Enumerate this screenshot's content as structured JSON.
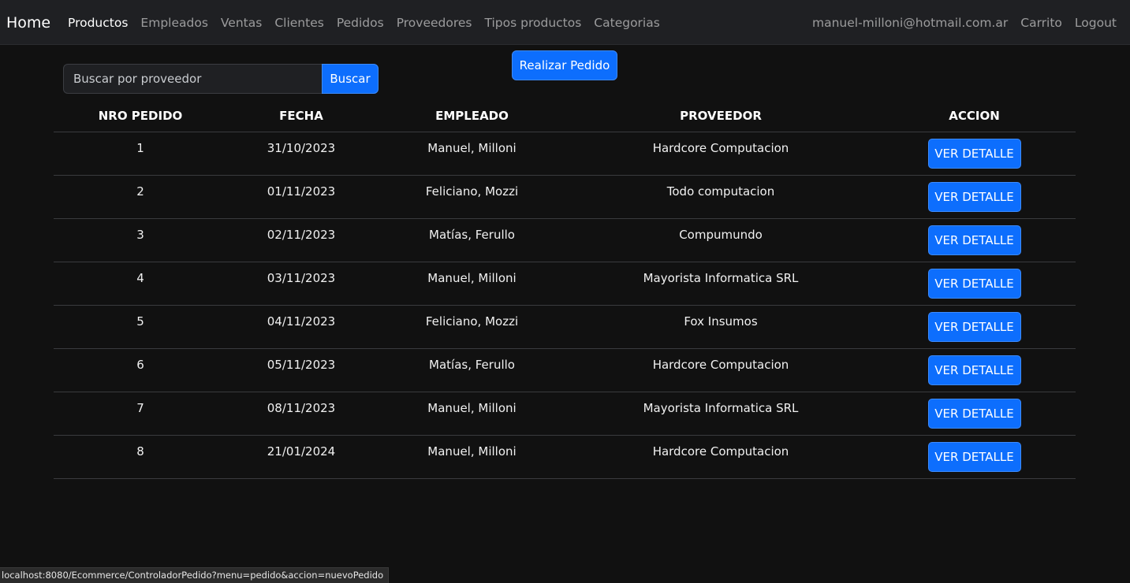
{
  "nav": {
    "brand": "Home",
    "links": [
      "Productos",
      "Empleados",
      "Ventas",
      "Clientes",
      "Pedidos",
      "Proveedores",
      "Tipos productos",
      "Categorias"
    ],
    "user_email": "manuel-milloni@hotmail.com.ar",
    "cart": "Carrito",
    "logout": "Logout"
  },
  "search": {
    "placeholder": "Buscar por proveedor",
    "value": "",
    "button": "Buscar"
  },
  "order_button": "Realizar Pedido",
  "table": {
    "headers": [
      "NRO PEDIDO",
      "FECHA",
      "EMPLEADO",
      "PROVEEDOR",
      "ACCION"
    ],
    "action_label": "VER DETALLE",
    "rows": [
      {
        "nro": "1",
        "fecha": "31/10/2023",
        "empleado": "Manuel, Milloni",
        "proveedor": "Hardcore Computacion"
      },
      {
        "nro": "2",
        "fecha": "01/11/2023",
        "empleado": "Feliciano, Mozzi",
        "proveedor": "Todo computacion"
      },
      {
        "nro": "3",
        "fecha": "02/11/2023",
        "empleado": "Matías, Ferullo",
        "proveedor": "Compumundo"
      },
      {
        "nro": "4",
        "fecha": "03/11/2023",
        "empleado": "Manuel, Milloni",
        "proveedor": "Mayorista Informatica SRL"
      },
      {
        "nro": "5",
        "fecha": "04/11/2023",
        "empleado": "Feliciano, Mozzi",
        "proveedor": "Fox Insumos"
      },
      {
        "nro": "6",
        "fecha": "05/11/2023",
        "empleado": "Matías, Ferullo",
        "proveedor": "Hardcore Computacion"
      },
      {
        "nro": "7",
        "fecha": "08/11/2023",
        "empleado": "Manuel, Milloni",
        "proveedor": "Mayorista Informatica SRL"
      },
      {
        "nro": "8",
        "fecha": "21/01/2024",
        "empleado": "Manuel, Milloni",
        "proveedor": "Hardcore Computacion"
      }
    ]
  },
  "status_bar": "localhost:8080/Ecommerce/ControladorPedido?menu=pedido&accion=nuevoPedido",
  "colors": {
    "background": "#111111",
    "navbar": "#1f2023",
    "primary": "#0d6efd"
  }
}
